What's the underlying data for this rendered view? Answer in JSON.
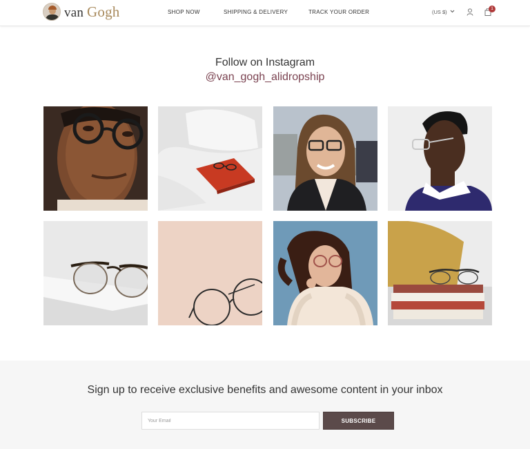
{
  "header": {
    "brand_prefix": "van",
    "brand_name": "Gogh",
    "nav": [
      "SHOP NOW",
      "SHIPPING & DELIVERY",
      "TRACK YOUR ORDER"
    ],
    "currency": "(US $)",
    "cart_count": "1",
    "icons": {
      "user": "user-icon",
      "cart": "shopping-bag-icon",
      "currency_caret": "chevron-down-icon"
    }
  },
  "instagram": {
    "title": "Follow on Instagram",
    "handle": "@van_gogh_alidropship",
    "tiles": [
      "man-with-glasses-photo",
      "red-book-with-glasses-photo",
      "smiling-woman-glasses-photo",
      "man-profile-glasses-photo",
      "glasses-on-white-book-photo",
      "round-glasses-on-pink-photo",
      "woman-fur-coat-glasses-photo",
      "glasses-on-book-stack-photo"
    ]
  },
  "signup": {
    "title": "Sign up to receive exclusive benefits and awesome content in your inbox",
    "email_placeholder": "Your Email",
    "button_label": "SUBSCRIBE"
  },
  "colors": {
    "brand_gold": "#a88a5c",
    "handle": "#7a4250",
    "button": "#5b4a4a",
    "badge": "#b03a3a"
  }
}
